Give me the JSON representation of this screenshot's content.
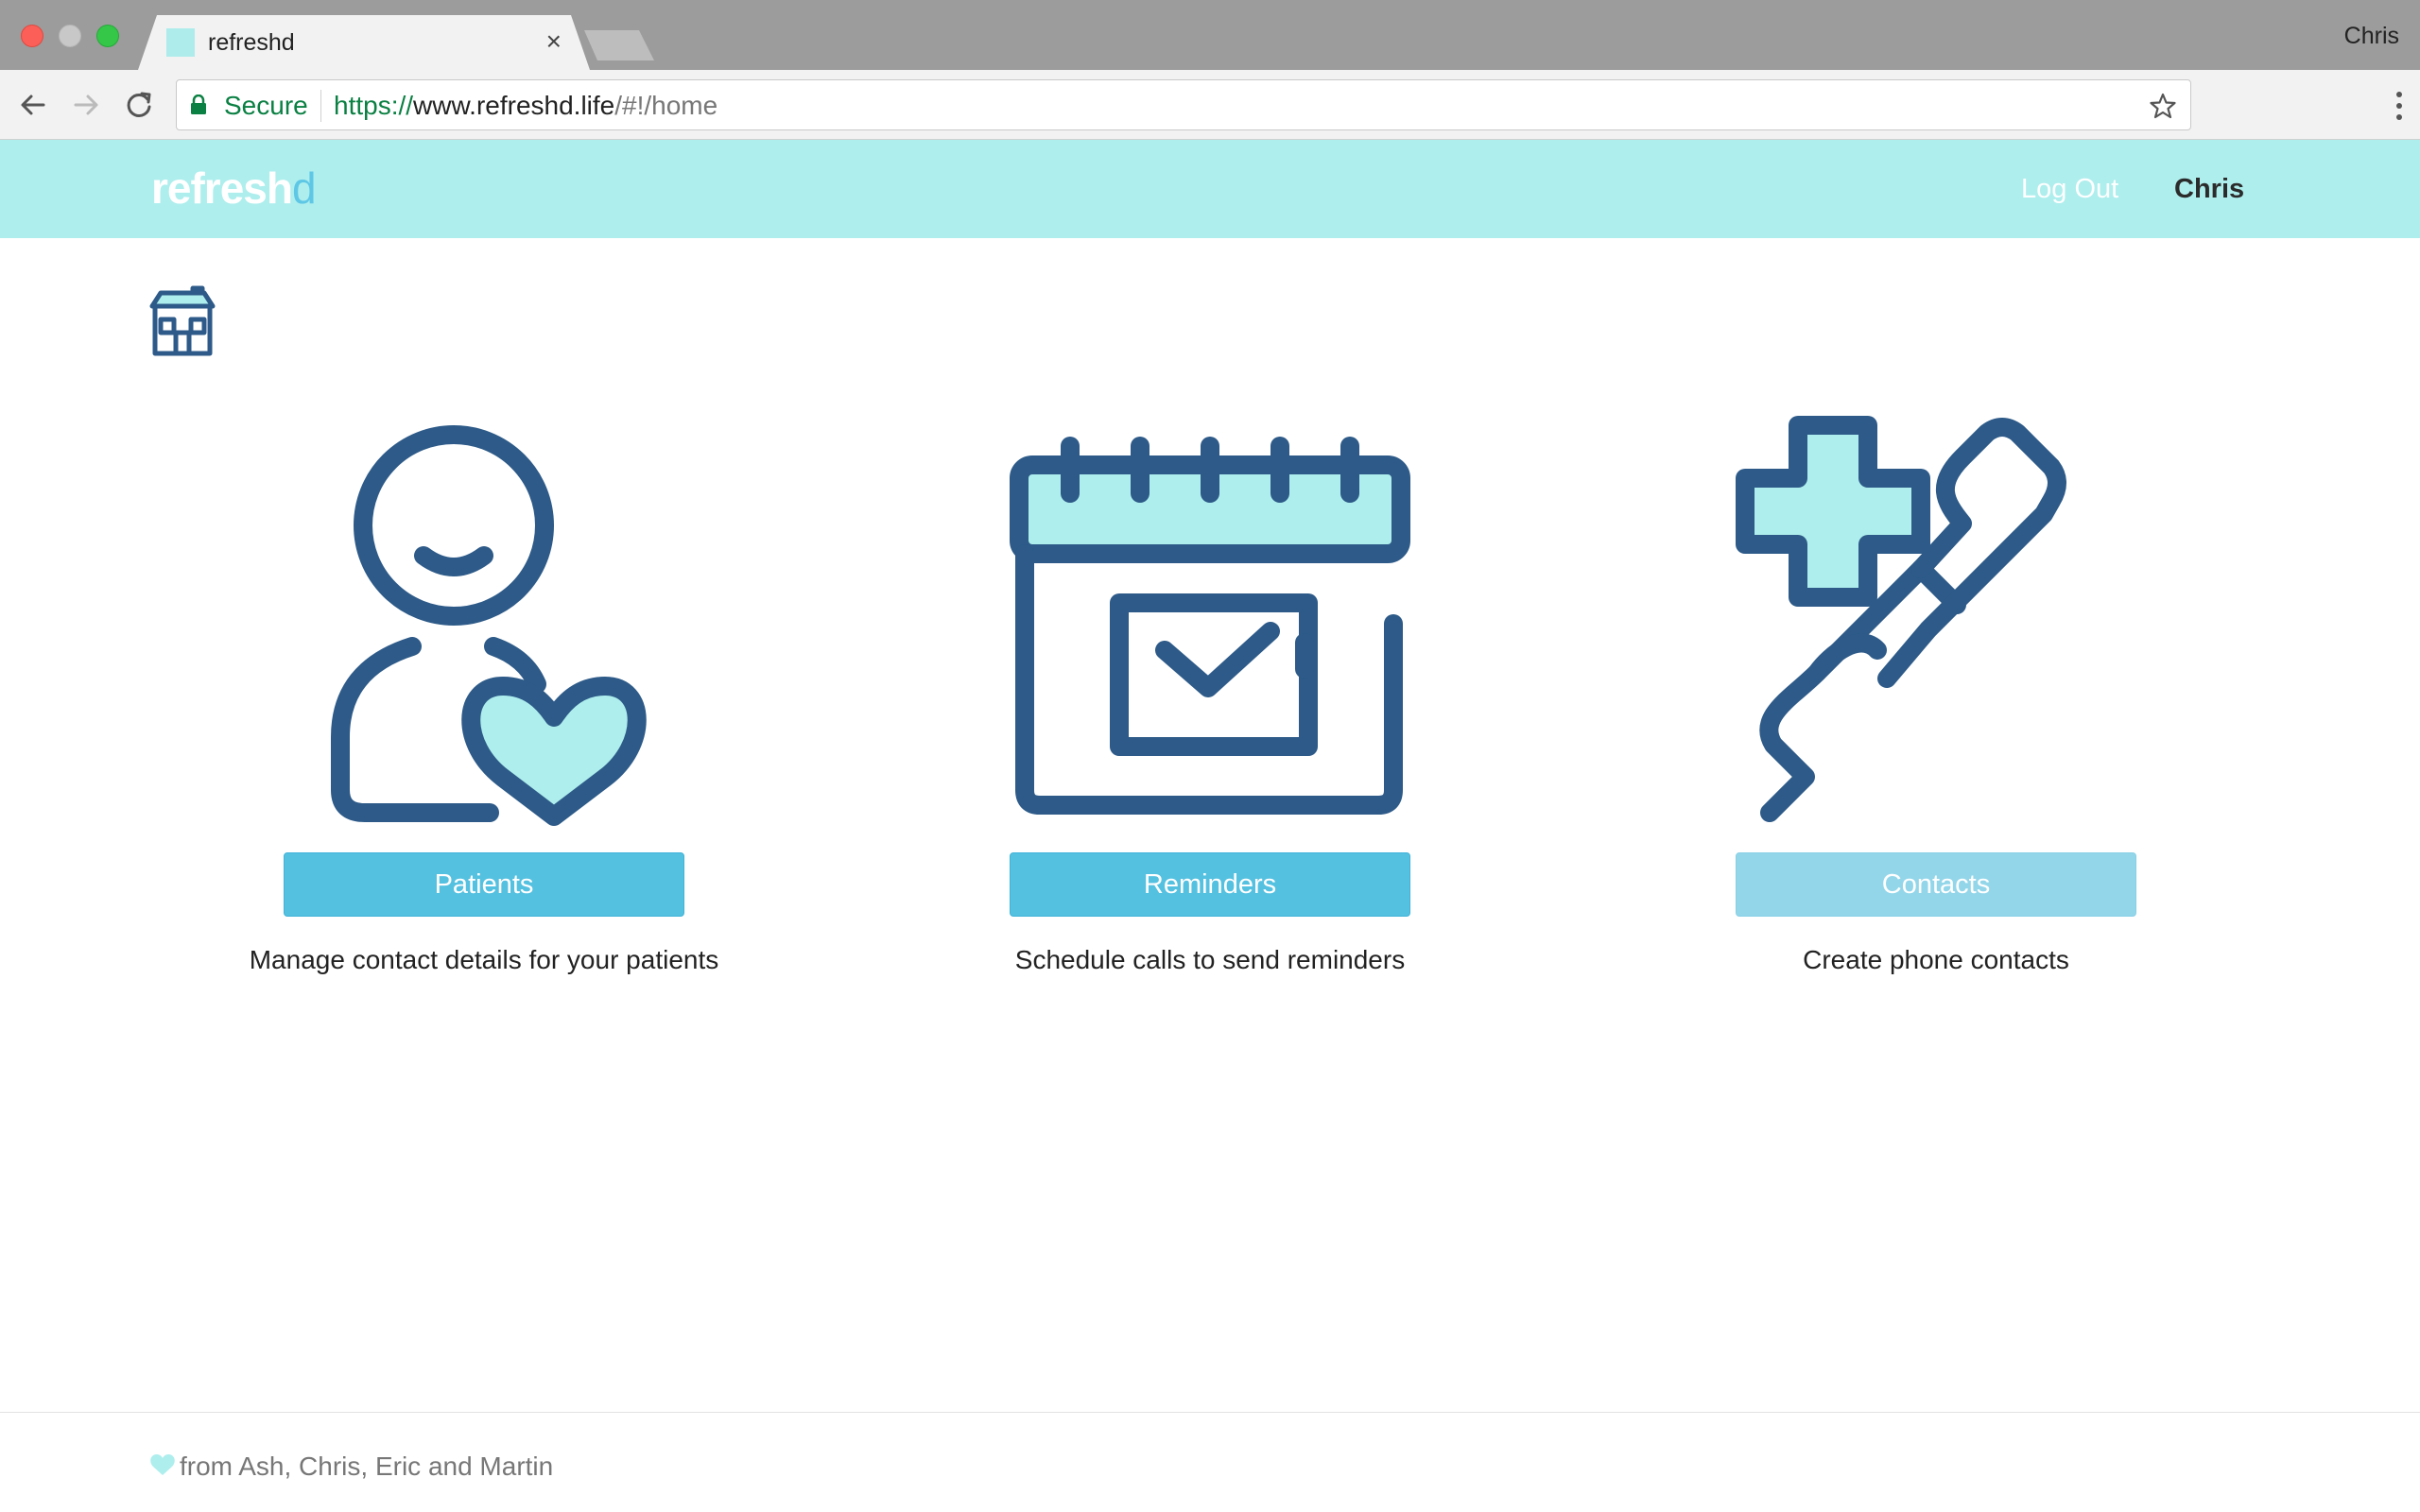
{
  "browser": {
    "tab_title": "refreshd",
    "tab_close": "×",
    "profile_name": "Chris",
    "secure_label": "Secure",
    "url_scheme": "https://",
    "url_host": "www.refreshd.life",
    "url_path": "/#!/home"
  },
  "header": {
    "logo_main": "refresh",
    "logo_accent": "d",
    "logout_label": "Log Out",
    "username": "Chris"
  },
  "cards": [
    {
      "illustration": "patient-heart-icon",
      "button_label": "Patients",
      "description": "Manage contact details for your patients"
    },
    {
      "illustration": "calendar-check-icon",
      "button_label": "Reminders",
      "description": "Schedule calls to send reminders"
    },
    {
      "illustration": "medical-phone-icon",
      "button_label": "Contacts",
      "description": "Create phone contacts"
    }
  ],
  "footer": {
    "text": "from Ash, Chris, Eric and Martin"
  },
  "colors": {
    "header_bg": "#aeeeed",
    "icon_stroke": "#2d5a88",
    "icon_fill": "#aeeeed",
    "button": "#55c1e0",
    "button_disabled": "#93d6ea"
  }
}
